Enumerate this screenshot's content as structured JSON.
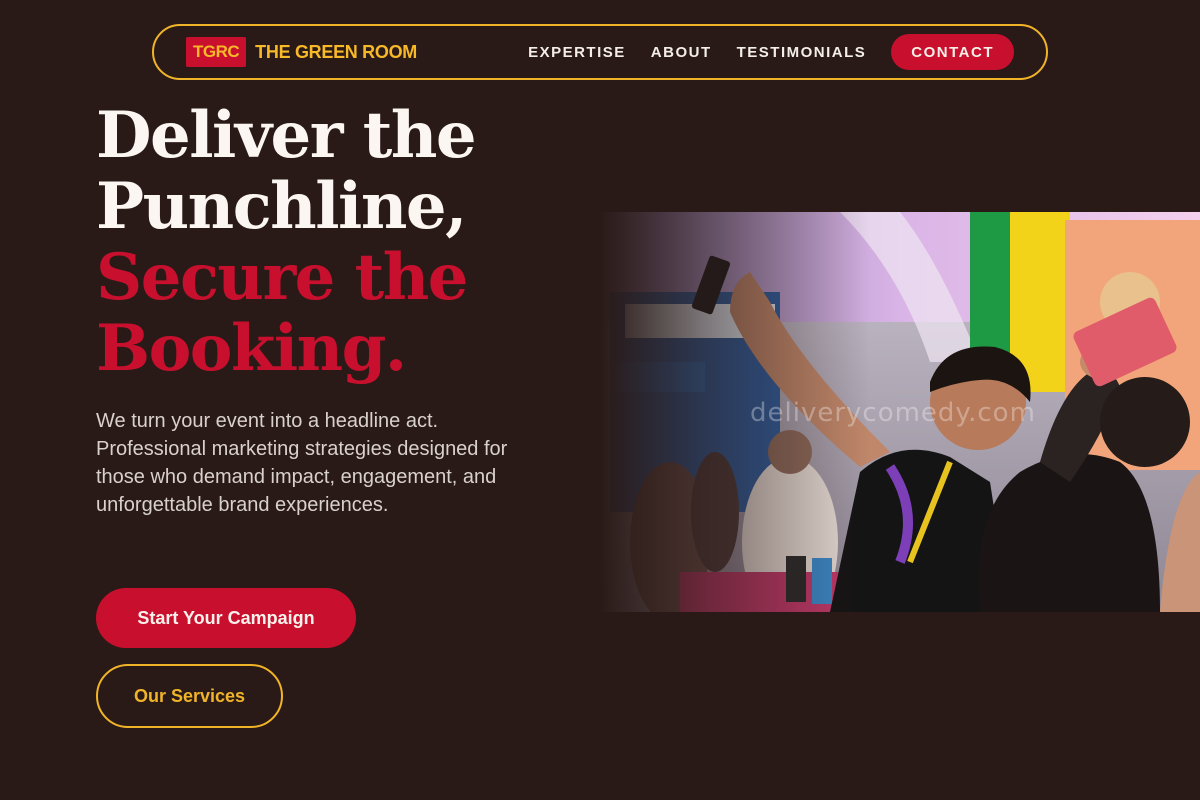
{
  "brand": {
    "badge": "TGRC",
    "name": "THE GREEN ROOM"
  },
  "nav": {
    "links": [
      "EXPERTISE",
      "ABOUT",
      "TESTIMONIALS"
    ],
    "cta": "CONTACT"
  },
  "hero": {
    "headline_line1": "Deliver the",
    "headline_line2": "Punchline,",
    "headline_line3": "Secure the",
    "headline_line4": "Booking.",
    "subtext": "We turn your event into a headline act. Professional marketing strategies designed for those who demand impact, engagement, and unforgettable brand experiences.",
    "primary_button": "Start Your Campaign",
    "secondary_button": "Our Services",
    "image_watermark": "deliverycomedy.com"
  },
  "colors": {
    "background": "#2a1a17",
    "accent_red": "#c8102e",
    "accent_gold": "#f0b429",
    "text_light": "#fbf6f1"
  }
}
